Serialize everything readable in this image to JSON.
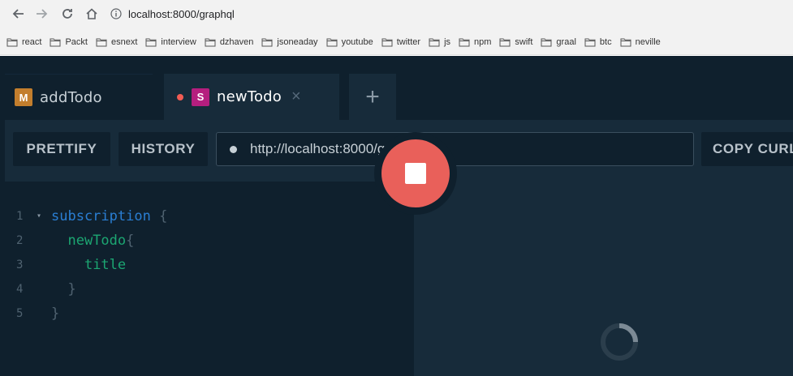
{
  "browser": {
    "url": "localhost:8000/graphql",
    "bookmarks": [
      "react",
      "Packt",
      "esnext",
      "interview",
      "dzhaven",
      "jsoneaday",
      "youtube",
      "twitter",
      "js",
      "npm",
      "swift",
      "graal",
      "btc",
      "neville"
    ]
  },
  "playground": {
    "tabs": [
      {
        "badge": "M",
        "title": "addTodo",
        "badge_color": "#c37e2d"
      },
      {
        "badge": "S",
        "title": "newTodo",
        "badge_color": "#b51e7e",
        "close": "×"
      }
    ],
    "add_tab": "+",
    "toolbar": {
      "prettify": "PRETTIFY",
      "history": "HISTORY",
      "endpoint": "http://localhost:8000/graphql",
      "copy_curl": "COPY CURL"
    },
    "editor": {
      "line_numbers": [
        "1",
        "2",
        "3",
        "4",
        "5"
      ],
      "lines": [
        {
          "indent": "",
          "keyword": "subscription",
          "field": "",
          "punct": " {"
        },
        {
          "indent": "  ",
          "keyword": "",
          "field": "newTodo",
          "punct": "{"
        },
        {
          "indent": "    ",
          "keyword": "",
          "field": "title",
          "punct": ""
        },
        {
          "indent": "  ",
          "keyword": "",
          "field": "",
          "punct": "}"
        },
        {
          "indent": "",
          "keyword": "",
          "field": "",
          "punct": "}"
        }
      ]
    },
    "colors": {
      "background": "#0f202d",
      "panel": "#172b3a",
      "stop_button": "#e9605a",
      "keyword": "#2a7ed3",
      "field": "#1ca672"
    },
    "icons": {
      "run": "stop-icon",
      "loading": "spinner-icon"
    }
  }
}
